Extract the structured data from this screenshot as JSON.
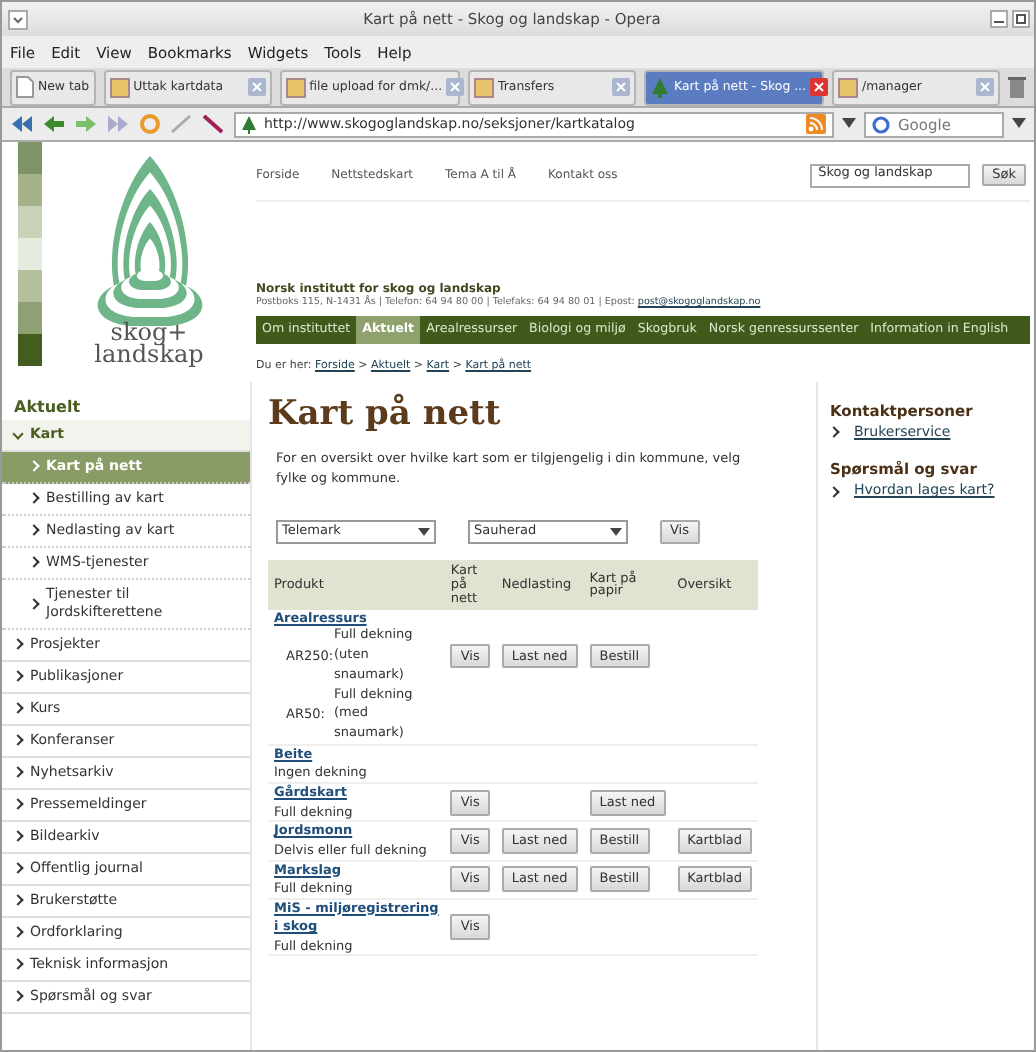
{
  "window": {
    "title": "Kart på nett - Skog og landskap - Opera"
  },
  "menu": [
    "File",
    "Edit",
    "View",
    "Bookmarks",
    "Widgets",
    "Tools",
    "Help"
  ],
  "tabs": [
    {
      "label": "New tab",
      "kind": "new",
      "selected": false
    },
    {
      "label": "Uttak kartdata",
      "kind": "page",
      "selected": false
    },
    {
      "label": "file upload for dmk/...",
      "kind": "page",
      "selected": false
    },
    {
      "label": "Transfers",
      "kind": "page",
      "selected": false
    },
    {
      "label": "Kart på nett - Skog ...",
      "kind": "page",
      "selected": true
    },
    {
      "label": "/manager",
      "kind": "page",
      "selected": false
    }
  ],
  "address_bar": {
    "url": "http://www.skogoglandskap.no/seksjoner/kartkatalog",
    "search_placeholder": "Google"
  },
  "site": {
    "logo": {
      "line_1": "skog+",
      "line_2": "landskap"
    },
    "top_links": [
      "Forside",
      "Nettstedskart",
      "Tema A til Å",
      "Kontakt oss"
    ],
    "search": {
      "value": "Skog og landskap",
      "button": "Søk"
    },
    "org_name": "Norsk institutt for skog og landskap",
    "org_address": "Postboks 115, N-1431 Ås | Telefon: 64 94 80 00 | Telefaks: 64 94 80 01 | Epost:",
    "org_email": "post@skogoglandskap.no",
    "nav": [
      {
        "label": "Om instituttet",
        "selected": false
      },
      {
        "label": "Aktuelt",
        "selected": true
      },
      {
        "label": "Arealressurser",
        "selected": false
      },
      {
        "label": "Biologi og miljø",
        "selected": false
      },
      {
        "label": "Skogbruk",
        "selected": false
      },
      {
        "label": "Norsk genressurssenter",
        "selected": false
      },
      {
        "label": "Information in English",
        "selected": false
      }
    ],
    "breadcrumb": {
      "prefix": "Du er her:",
      "separator": ">",
      "links": [
        "Forside",
        "Aktuelt",
        "Kart",
        "Kart på nett"
      ]
    }
  },
  "sidebar": {
    "heading": "Aktuelt",
    "items": [
      {
        "label": "Kart",
        "expanded": true,
        "selected": false,
        "children": [
          {
            "label": "Kart på nett",
            "selected": true
          },
          {
            "label": "Bestilling av kart",
            "selected": false
          },
          {
            "label": "Nedlasting av kart",
            "selected": false
          },
          {
            "label": "WMS-tjenester",
            "selected": false
          },
          {
            "label": "Tjenester til Jordskifterettene",
            "selected": false
          }
        ]
      },
      {
        "label": "Prosjekter",
        "expanded": false,
        "selected": false
      },
      {
        "label": "Publikasjoner",
        "expanded": false,
        "selected": false
      },
      {
        "label": "Kurs",
        "expanded": false,
        "selected": false
      },
      {
        "label": "Konferanser",
        "expanded": false,
        "selected": false
      },
      {
        "label": "Nyhetsarkiv",
        "expanded": false,
        "selected": false
      },
      {
        "label": "Pressemeldinger",
        "expanded": false,
        "selected": false
      },
      {
        "label": "Bildearkiv",
        "expanded": false,
        "selected": false
      },
      {
        "label": "Offentlig journal",
        "expanded": false,
        "selected": false
      },
      {
        "label": "Brukerstøtte",
        "expanded": false,
        "selected": false
      },
      {
        "label": "Ordforklaring",
        "expanded": false,
        "selected": false
      },
      {
        "label": "Teknisk informasjon",
        "expanded": false,
        "selected": false
      },
      {
        "label": "Spørsmål og svar",
        "expanded": false,
        "selected": false
      }
    ]
  },
  "main": {
    "title": "Kart på nett",
    "intro": "For en oversikt over hvilke kart som er tilgjengelig i din kommune, velg fylke og kommune.",
    "selects": [
      "Telemark",
      "Sauherad"
    ],
    "show_button": "Vis",
    "table": {
      "columns": [
        "Produkt",
        "Kart på nett",
        "Nedlasting",
        "Kart på papir",
        "Oversikt"
      ],
      "rows": [
        {
          "product": "Arealressurs",
          "variants": [
            {
              "code": "AR250:",
              "coverage": "Full dekning (uten snaumark)",
              "buttons": {
                "kart_pa_nett": "Vis",
                "nedlasting": "Last ned",
                "kart_pa_papir": "Bestill"
              }
            },
            {
              "code": "AR50:",
              "coverage": "Full dekning (med snaumark)"
            }
          ]
        },
        {
          "product": "Beite",
          "coverage": "Ingen dekning"
        },
        {
          "product": "Gårdskart",
          "coverage": "Full dekning",
          "buttons": {
            "kart_pa_nett": "Vis",
            "kart_pa_papir": "Last ned"
          }
        },
        {
          "product": "Jordsmonn",
          "coverage": "Delvis eller full dekning",
          "buttons": {
            "kart_pa_nett": "Vis",
            "nedlasting": "Last ned",
            "kart_pa_papir": "Bestill",
            "oversikt": "Kartblad"
          }
        },
        {
          "product": "Markslag",
          "coverage": "Full dekning",
          "buttons": {
            "kart_pa_nett": "Vis",
            "nedlasting": "Last ned",
            "kart_pa_papir": "Bestill",
            "oversikt": "Kartblad"
          }
        },
        {
          "product": "MiS - miljøregistrering i skog",
          "coverage": "Full dekning",
          "buttons": {
            "kart_pa_nett": "Vis"
          }
        }
      ]
    }
  },
  "aside": [
    {
      "heading": "Kontaktpersoner",
      "links": [
        "Brukerservice"
      ]
    },
    {
      "heading": "Spørsmål og svar",
      "links": [
        "Hvordan lages kart?"
      ]
    }
  ]
}
